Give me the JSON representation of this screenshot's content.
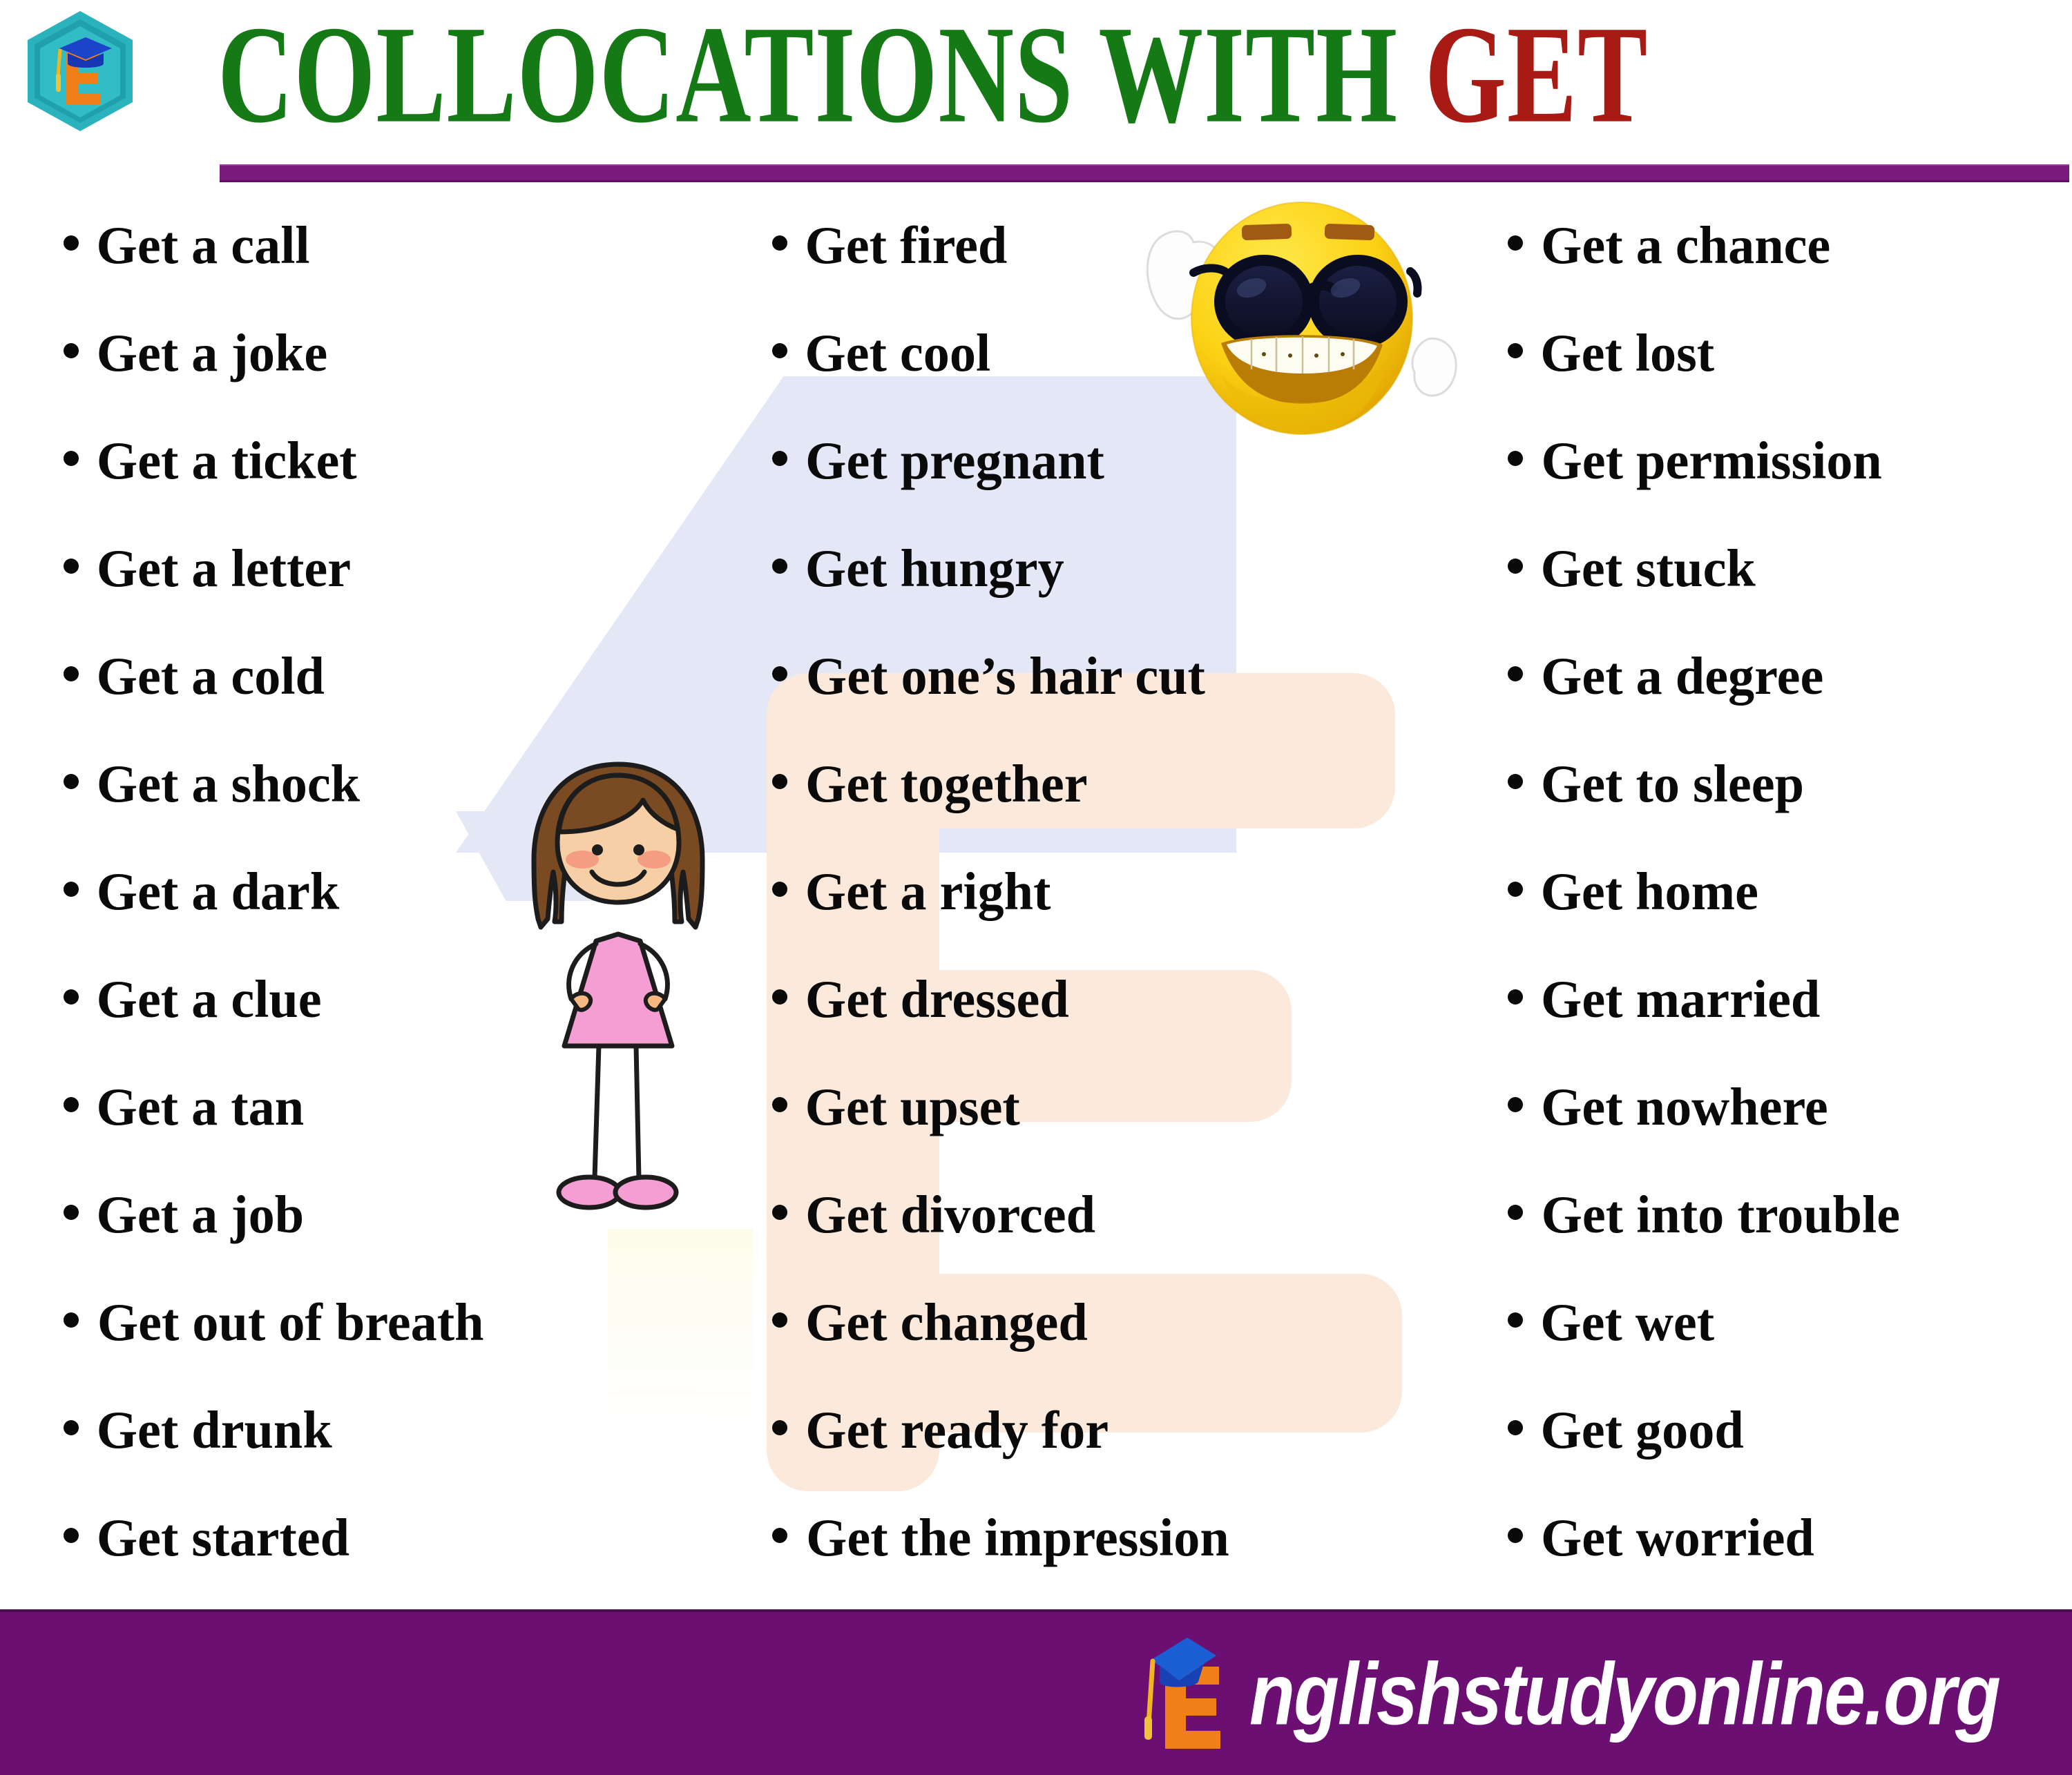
{
  "header": {
    "logo_icon": "graduation-cap-e-logo",
    "title_main": "COLLOCATIONS WITH ",
    "title_accent": "GET",
    "title_main_color": "#157A16",
    "title_accent_color": "#A81A14",
    "rule_color": "#7A1A7E"
  },
  "decorations": {
    "girl_illustration": "girl-illustration",
    "emoji_illustration": "cool-sunglasses-emoji",
    "watermark_cap": "graduation-cap-watermark",
    "watermark_letter": "letter-e-watermark",
    "watermark_cap_color": "#e3e7f6",
    "watermark_letter_color": "#fbeadc"
  },
  "columns": [
    {
      "id": "column-1",
      "items": [
        "Get a call",
        "Get a joke",
        "Get a ticket",
        "Get a letter",
        "Get a cold",
        "Get a shock",
        "Get a dark",
        "Get a clue",
        "Get a tan",
        "Get a job",
        "Get out of breath",
        "Get drunk",
        "Get started"
      ]
    },
    {
      "id": "column-2",
      "items": [
        "Get fired",
        "Get cool",
        "Get pregnant",
        "Get hungry",
        "Get one’s hair cut",
        "Get together",
        "Get a right",
        "Get dressed",
        "Get upset",
        "Get divorced",
        "Get changed",
        "Get ready for",
        "Get the impression"
      ]
    },
    {
      "id": "column-3",
      "items": [
        "Get a chance",
        "Get lost",
        "Get permission",
        "Get stuck",
        "Get a degree",
        "Get to sleep",
        "Get home",
        "Get married",
        "Get nowhere",
        "Get into trouble",
        "Get wet",
        "Get good",
        "Get worried"
      ]
    }
  ],
  "footer": {
    "background_color": "#6B1072",
    "logo_icon": "graduation-cap-e-logo",
    "brand_letter": "E",
    "brand_text": "nglishstudyonline.org",
    "brand_text_color": "#ffffff"
  }
}
